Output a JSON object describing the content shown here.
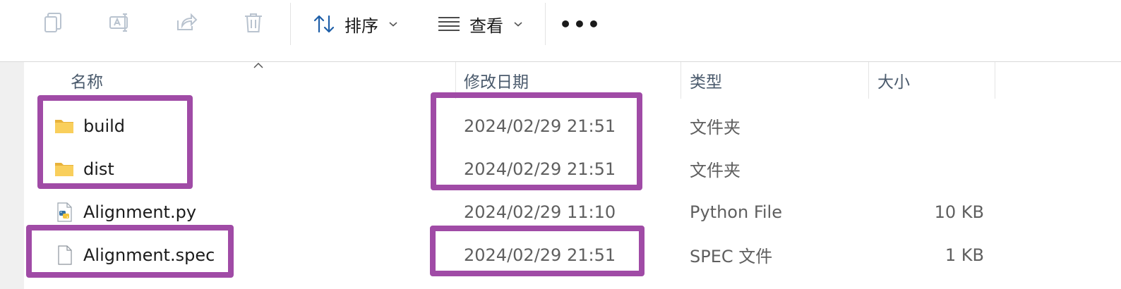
{
  "toolbar": {
    "icons": [
      {
        "name": "copy-icon"
      },
      {
        "name": "rename-icon"
      },
      {
        "name": "share-icon"
      },
      {
        "name": "delete-icon"
      }
    ],
    "sort_label": "排序",
    "view_label": "查看",
    "more_label": "•••"
  },
  "columns": {
    "name": "名称",
    "modified": "修改日期",
    "type": "类型",
    "size": "大小"
  },
  "files": [
    {
      "name": "build",
      "modified": "2024/02/29 21:51",
      "type": "文件夹",
      "size": "",
      "icon": "folder-icon"
    },
    {
      "name": "dist",
      "modified": "2024/02/29 21:51",
      "type": "文件夹",
      "size": "",
      "icon": "folder-icon"
    },
    {
      "name": "Alignment.py",
      "modified": "2024/02/29 11:10",
      "type": "Python File",
      "size": "10 KB",
      "icon": "python-file-icon"
    },
    {
      "name": "Alignment.spec",
      "modified": "2024/02/29 21:51",
      "type": "SPEC 文件",
      "size": "1 KB",
      "icon": "file-icon"
    }
  ],
  "colors": {
    "highlight": "#a04ba6",
    "folder": "#f5c542"
  }
}
